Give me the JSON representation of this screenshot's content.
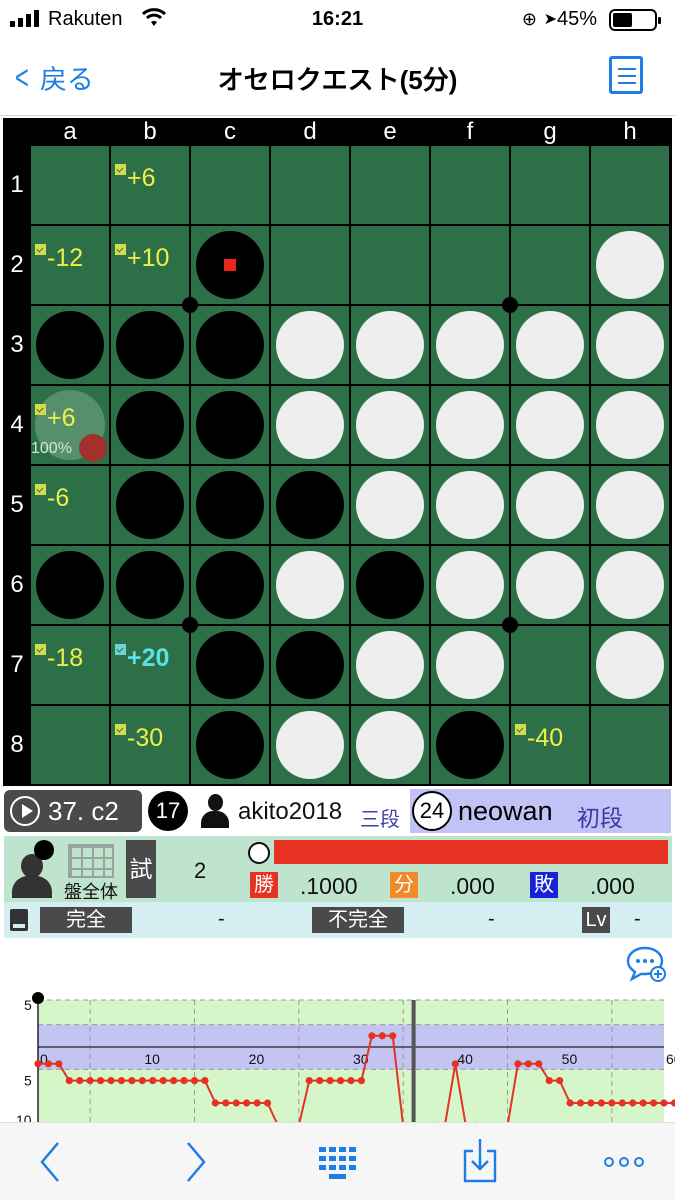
{
  "status_bar": {
    "carrier": "Rakuten",
    "time": "16:21",
    "battery": "45%"
  },
  "nav": {
    "back_label": "戻る",
    "title": "オセロクエスト(5分)"
  },
  "board": {
    "columns": [
      "a",
      "b",
      "c",
      "d",
      "e",
      "f",
      "g",
      "h"
    ],
    "rows": [
      "1",
      "2",
      "3",
      "4",
      "5",
      "6",
      "7",
      "8"
    ],
    "cells": [
      [
        "empty",
        "hint:+6",
        "empty",
        "empty",
        "empty",
        "empty",
        "empty",
        "empty"
      ],
      [
        "hint:-12",
        "hint:+10",
        "black-last",
        "empty",
        "empty",
        "empty",
        "empty",
        "white"
      ],
      [
        "black",
        "black",
        "black",
        "white",
        "white",
        "white",
        "white",
        "white"
      ],
      [
        "hint:+6",
        "black",
        "black",
        "white",
        "white",
        "white",
        "white",
        "white"
      ],
      [
        "hint:-6",
        "black",
        "black",
        "black",
        "white",
        "white",
        "white",
        "white"
      ],
      [
        "black",
        "black",
        "black",
        "white",
        "black",
        "white",
        "white",
        "white"
      ],
      [
        "hint:-18",
        "hint-best:+20",
        "black",
        "black",
        "white",
        "white",
        "empty",
        "white"
      ],
      [
        "empty",
        "hint:-30",
        "black",
        "white",
        "white",
        "black",
        "hint:-40",
        "empty"
      ]
    ],
    "selected_percent": "100%"
  },
  "move_info": {
    "move_label": "37. c2",
    "black_count": "17",
    "black_name": "akito2018",
    "black_rank": "三段",
    "white_count": "24",
    "white_name": "neowan",
    "white_rank": "初段"
  },
  "analysis": {
    "grid_label": "盤全体",
    "try_label": "試",
    "try_value": "2",
    "win_label": "勝",
    "win_value": ".1000",
    "draw_label": "分",
    "draw_value": ".000",
    "loss_label": "敗",
    "loss_value": ".000"
  },
  "solver": {
    "perfect_label": "完全",
    "perfect_value": "-",
    "imperfect_label": "不完全",
    "imperfect_value": "-",
    "level_label": "Lv",
    "level_value": "-"
  },
  "chart_data": {
    "type": "line",
    "x_ticks": [
      "0",
      "10",
      "20",
      "30",
      "40",
      "50",
      "60"
    ],
    "y_ticks": [
      "5",
      "5",
      "10"
    ],
    "series": [
      {
        "values": [
          -3,
          -3,
          -3,
          -6,
          -6,
          -6,
          -6,
          -6,
          -6,
          -6,
          -6,
          -6,
          -6,
          -6,
          -6,
          -6,
          -6,
          -10,
          -10,
          -10,
          -10,
          -10,
          -10,
          -14,
          -14,
          -14,
          -6,
          -6,
          -6,
          -6,
          -6,
          -6,
          2,
          2,
          2,
          null,
          null,
          null,
          -14,
          -14,
          -3,
          -14,
          -14,
          null,
          null,
          null,
          -3,
          -3,
          -3,
          -6,
          -6,
          -10,
          -10,
          -10,
          -10,
          -10,
          -10,
          -10,
          -10,
          -10,
          -10,
          -10
        ]
      }
    ],
    "colors": {
      "line": "#e63223",
      "band": "#c3c4f2",
      "bg": "#d4f6c9"
    }
  },
  "toolbar": {
    "prev_icon": "chevron-left-icon",
    "next_icon": "chevron-right-icon",
    "keypad_icon": "keypad-icon",
    "save_icon": "download-icon",
    "more_icon": "more-icon"
  }
}
